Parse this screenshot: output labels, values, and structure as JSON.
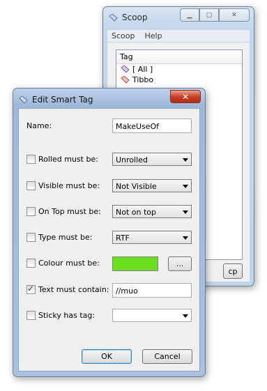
{
  "scoop_window": {
    "title": "Scoop",
    "menu": [
      "Scoop",
      "Help"
    ],
    "list_header": "Tag",
    "list_items": [
      "[ All ]",
      "Tibbo"
    ],
    "cp_label": "cp"
  },
  "dialog": {
    "title": "Edit Smart Tag",
    "close_label": "✕",
    "name_label": "Name:",
    "name_value": "MakeUseOf",
    "rows": [
      {
        "label": "Rolled must be:",
        "checked": false,
        "value": "Unrolled"
      },
      {
        "label": "Visible must be:",
        "checked": false,
        "value": "Not Visible"
      },
      {
        "label": "On Top must be:",
        "checked": false,
        "value": "Not on top"
      },
      {
        "label": "Type must be:",
        "checked": false,
        "value": "RTF"
      },
      {
        "label": "Colour must be:",
        "checked": false,
        "color": "#6ce01e",
        "button_label": "..."
      },
      {
        "label": "Text must contain:",
        "checked": true,
        "value": "//muo"
      },
      {
        "label": "Sticky has tag:",
        "checked": false,
        "value": ""
      }
    ],
    "ok_label": "OK",
    "cancel_label": "Cancel"
  }
}
